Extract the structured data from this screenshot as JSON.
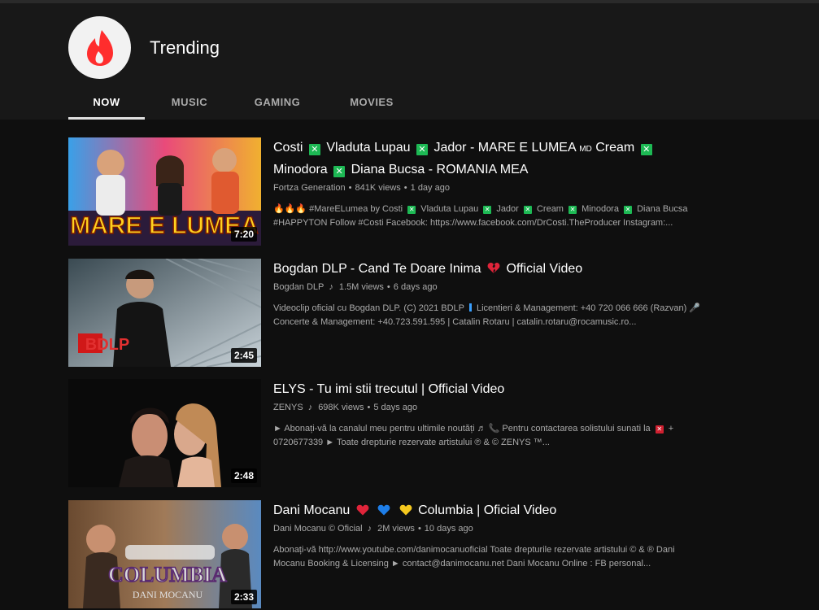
{
  "header": {
    "title": "Trending",
    "tabs": [
      {
        "label": "NOW",
        "active": true
      },
      {
        "label": "MUSIC",
        "active": false
      },
      {
        "label": "GAMING",
        "active": false
      },
      {
        "label": "MOVIES",
        "active": false
      }
    ]
  },
  "videos": [
    {
      "title_parts": [
        "Costi",
        "Vladuta Lupau",
        "Jador - MARE E LUMEA",
        "MD",
        "Cream",
        "Minodora",
        "Diana Bucsa - ROMANIA MEA"
      ],
      "channel": "Fortza Generation",
      "views": "841K views",
      "age": "1 day ago",
      "desc_parts": [
        "#MareELumea by Costi",
        "Vladuta Lupau",
        "Jador",
        "Cream",
        "Minodora",
        "Diana Bucsa"
      ],
      "desc_line2": "#HAPPYTON Follow #Costi Facebook: https://www.facebook.com/DrCosti.TheProducer Instagram:...",
      "thumb_text": "MARE E LUMEA",
      "duration": "7:20"
    },
    {
      "title_a": "Bogdan DLP - Cand Te Doare Inima",
      "title_b": "Official Video",
      "channel": "Bogdan DLP",
      "views": "1.5M views",
      "age": "6 days ago",
      "desc_line1": "Videoclip oficial cu Bogdan DLP. (C) 2021 BDLP",
      "desc_line1b": "Licentieri & Management: +40 720 066 666 (Razvan)",
      "desc_line2": "Concerte & Management: +40.723.591.595 | Catalin Rotaru | catalin.rotaru@rocamusic.ro...",
      "thumb_text": "BDLP",
      "duration": "2:45"
    },
    {
      "title": "ELYS - Tu imi stii trecutul | Official Video",
      "channel": "ZENYS",
      "views": "698K views",
      "age": "5 days ago",
      "desc_line1a": "► Abonați-vă la canalul meu pentru ultimile noutăți ♬",
      "desc_line1b": "Pentru contactarea solistului sunati la",
      "desc_line1c": "+",
      "desc_line2": "0720677339 ► Toate drepturie rezervate artistului ℗ & © ZENYS ™...",
      "duration": "2:48"
    },
    {
      "title_a": "Dani Mocanu",
      "title_b": "Columbia | Oficial Video",
      "channel": "Dani Mocanu © Oficial",
      "views": "2M views",
      "age": "10 days ago",
      "desc_line1": "Abonați-vă http://www.youtube.com/danimocanuoficial Toate drepturile rezervate artistului © & ® Dani",
      "desc_line2": "Mocanu Booking & Licensing ► contact@danimocanu.net Dani Mocanu Online : FB personal...",
      "thumb_text": "COLUMBIA",
      "thumb_sub": "DANI MOCANU",
      "duration": "2:33"
    }
  ],
  "colors": {
    "background": "#0f0f0f",
    "header": "#181818",
    "accent_flame": "#ff2d2d",
    "muted_text": "#aaaaaa",
    "check_green": "#1db954"
  },
  "icons": [
    "trending-flame-icon",
    "music-note-icon",
    "green-x-emoji",
    "broken-heart-emoji",
    "red-heart-emoji",
    "blue-heart-emoji",
    "yellow-heart-emoji"
  ]
}
